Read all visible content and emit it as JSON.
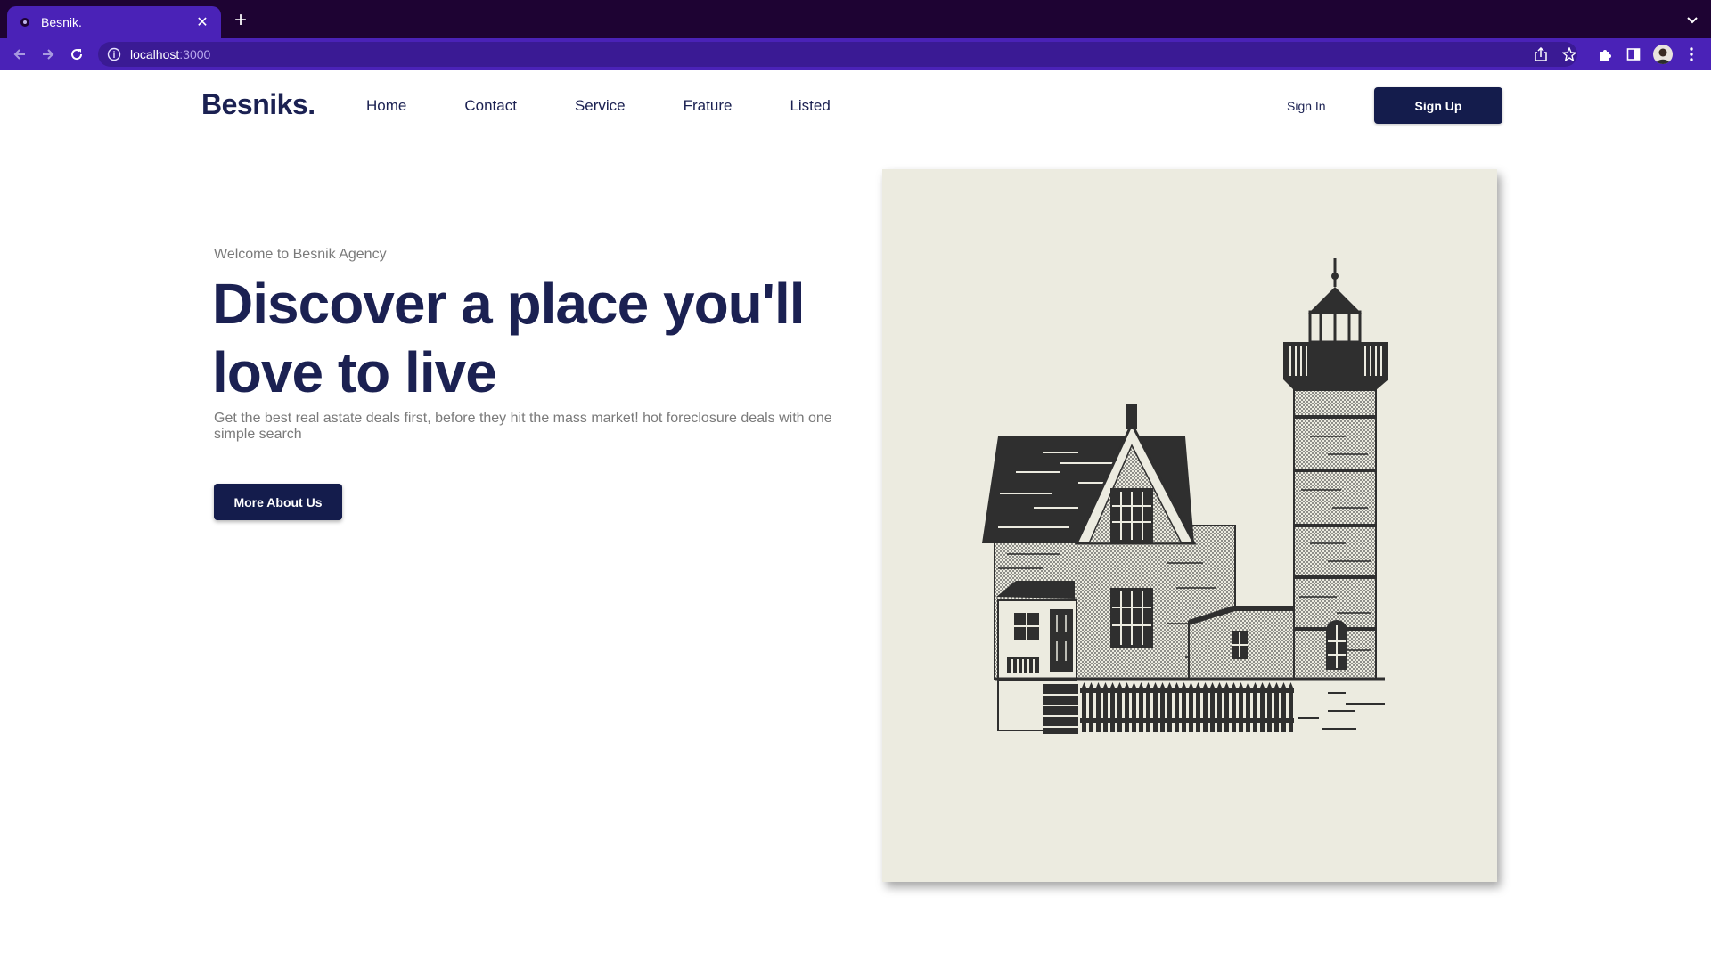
{
  "browser": {
    "tab_title": "Besnik.",
    "url_host": "localhost",
    "url_port": ":3000"
  },
  "site": {
    "logo": "Besniks.",
    "nav": [
      "Home",
      "Contact",
      "Service",
      "Frature",
      "Listed"
    ],
    "sign_in": "Sign In",
    "sign_up": "Sign Up"
  },
  "hero": {
    "kicker": "Welcome to Besnik Agency",
    "headline": "Discover a place you'll love to live",
    "lede": "Get the best real astate deals first, before they hit the mass market! hot foreclosure deals with one simple search",
    "cta": "More About Us"
  },
  "colors": {
    "brand": "#1b2152",
    "button": "#141c4c",
    "chrome": "#4a22b7",
    "art_bg": "#ecebe0"
  }
}
